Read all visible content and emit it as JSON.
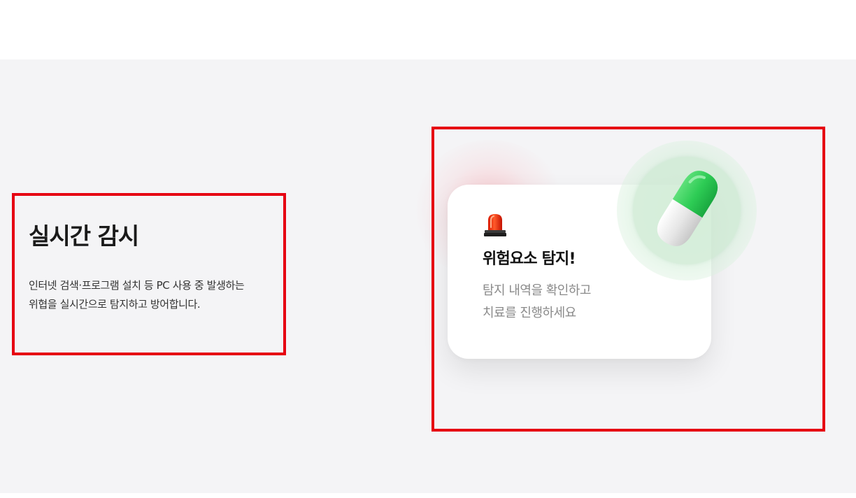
{
  "feature": {
    "title": "실시간 감시",
    "description_lines": [
      "인터넷 검색·프로그램 설치 등 PC 사용 중 발생하는",
      "위협을 실시간으로 탐지하고 방어합니다."
    ]
  },
  "alert_card": {
    "icon": "siren-icon",
    "title": "위험요소 탐지!",
    "description_lines": [
      "탐지 내역을 확인하고",
      "치료를 진행하세요"
    ],
    "badge_icon": "capsule-pill-icon"
  },
  "colors": {
    "background": "#f4f4f6",
    "highlight_border": "#e60012",
    "pill_green": "#2ecc55",
    "alert_red": "#ff3a1a"
  }
}
